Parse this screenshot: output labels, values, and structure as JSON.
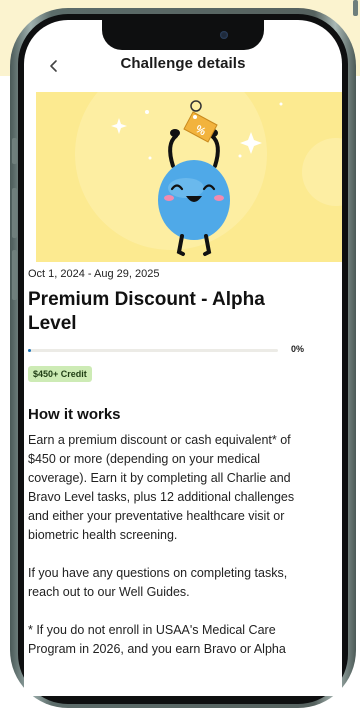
{
  "header": {
    "title": "Challenge details",
    "back_icon": "chevron-left-icon"
  },
  "hero": {
    "illustration": "mascot-holding-discount-tag",
    "tag_text": "%",
    "background": "#FCEA90"
  },
  "challenge": {
    "date_range": "Oct 1, 2024 - Aug 29, 2025",
    "title": "Premium Discount - Alpha Level",
    "progress_percent": 0,
    "progress_label": "0%",
    "credit_badge": "$450+ Credit"
  },
  "how_it_works": {
    "heading": "How it works",
    "paragraphs": [
      "Earn a premium discount or cash equivalent* of $450 or more (depending on your medical coverage). Earn it by completing all Charlie and Bravo Level tasks, plus 12 additional challenges and either your preventative healthcare visit or biometric health screening.",
      "If you have any questions on completing tasks, reach out to our Well Guides.",
      "* If you do not enroll in USAA's Medical Care Program in 2026, and you earn Bravo or Alpha"
    ]
  },
  "colors": {
    "accent_progress": "#1a73b8",
    "badge_bg": "#CDEBB5",
    "hero_bg": "#FCEA90",
    "tag": "#F2B33D",
    "mascot": "#4FA9E8"
  }
}
